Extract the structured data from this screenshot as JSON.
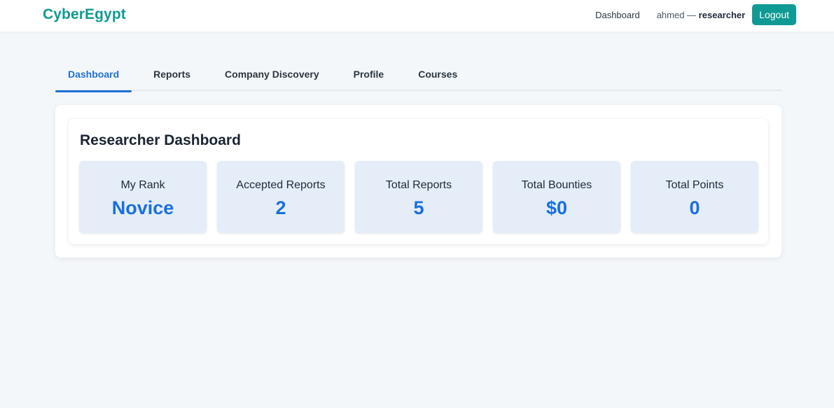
{
  "navbar": {
    "brand": "CyberEgypt",
    "dashboard_link": "Dashboard",
    "username": "ahmed",
    "separator": " — ",
    "role": "researcher",
    "logout_label": "Logout"
  },
  "tabs": [
    {
      "label": "Dashboard",
      "active": true
    },
    {
      "label": "Reports",
      "active": false
    },
    {
      "label": "Company Discovery",
      "active": false
    },
    {
      "label": "Profile",
      "active": false
    },
    {
      "label": "Courses",
      "active": false
    }
  ],
  "dashboard": {
    "title": "Researcher Dashboard",
    "stats": [
      {
        "label": "My Rank",
        "value": "Novice"
      },
      {
        "label": "Accepted Reports",
        "value": "2"
      },
      {
        "label": "Total Reports",
        "value": "5"
      },
      {
        "label": "Total Bounties",
        "value": "$0"
      },
      {
        "label": "Total Points",
        "value": "0"
      }
    ]
  },
  "colors": {
    "brand": "#0f9a94",
    "accent_blue": "#1e70d6",
    "stat_card_bg": "#e4edf8",
    "page_bg": "#f4f7fa"
  }
}
